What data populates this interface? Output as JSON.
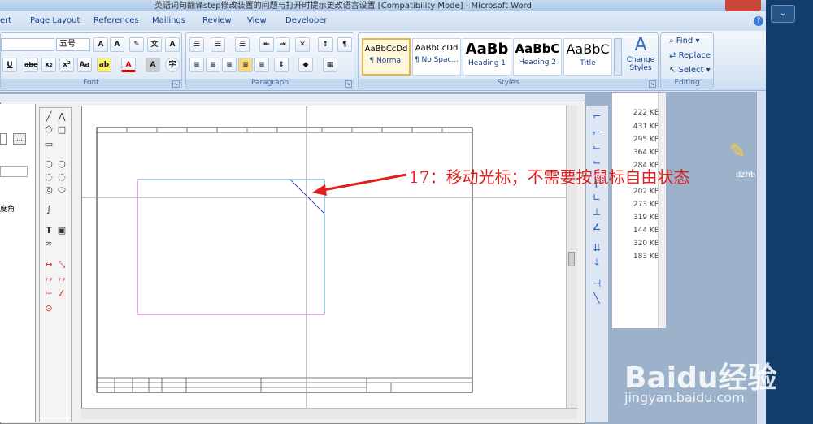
{
  "window": {
    "title": "英语词句翻译step修改装置的问题与打开时提示更改语言设置 [Compatibility Mode] - Microsoft Word"
  },
  "tabs": [
    "ert",
    "Page Layout",
    "References",
    "Mailings",
    "Review",
    "View",
    "Developer"
  ],
  "font": {
    "size": "五号",
    "group_label": "Font"
  },
  "paragraph": {
    "group_label": "Paragraph"
  },
  "styles": {
    "group_label": "Styles",
    "items": [
      {
        "sample": "AaBbCcDd",
        "name": "¶ Normal"
      },
      {
        "sample": "AaBbCcDd",
        "name": "¶ No Spac..."
      },
      {
        "sample": "AaBb",
        "name": "Heading 1"
      },
      {
        "sample": "AaBbC",
        "name": "Heading 2"
      },
      {
        "sample": "AaBbC",
        "name": "Title"
      }
    ],
    "change_styles": "Change Styles"
  },
  "editing": {
    "group_label": "Editing",
    "find": "Find",
    "replace": "Replace",
    "select": "Select"
  },
  "explorer": {
    "sizes": [
      "222 KB",
      "431 KB",
      "295 KB",
      "364 KB",
      "284 KB",
      "",
      "202 KB",
      "273 KB",
      "319 KB",
      "144 KB",
      "320 KB",
      "183 KB"
    ]
  },
  "left_panel": {
    "label": "度角"
  },
  "annotation": "17：移动光标；不需要按鼠标自由状态",
  "desktop_icon": {
    "label": "dzhb"
  },
  "watermark": {
    "brand": "Baidu经验",
    "url": "jingyan.baidu.com"
  },
  "colors": {
    "annotation": "#e02020",
    "selection_pink": "#c050c0",
    "selection_cyan": "#40a0c0",
    "diag": "#4040d0"
  }
}
